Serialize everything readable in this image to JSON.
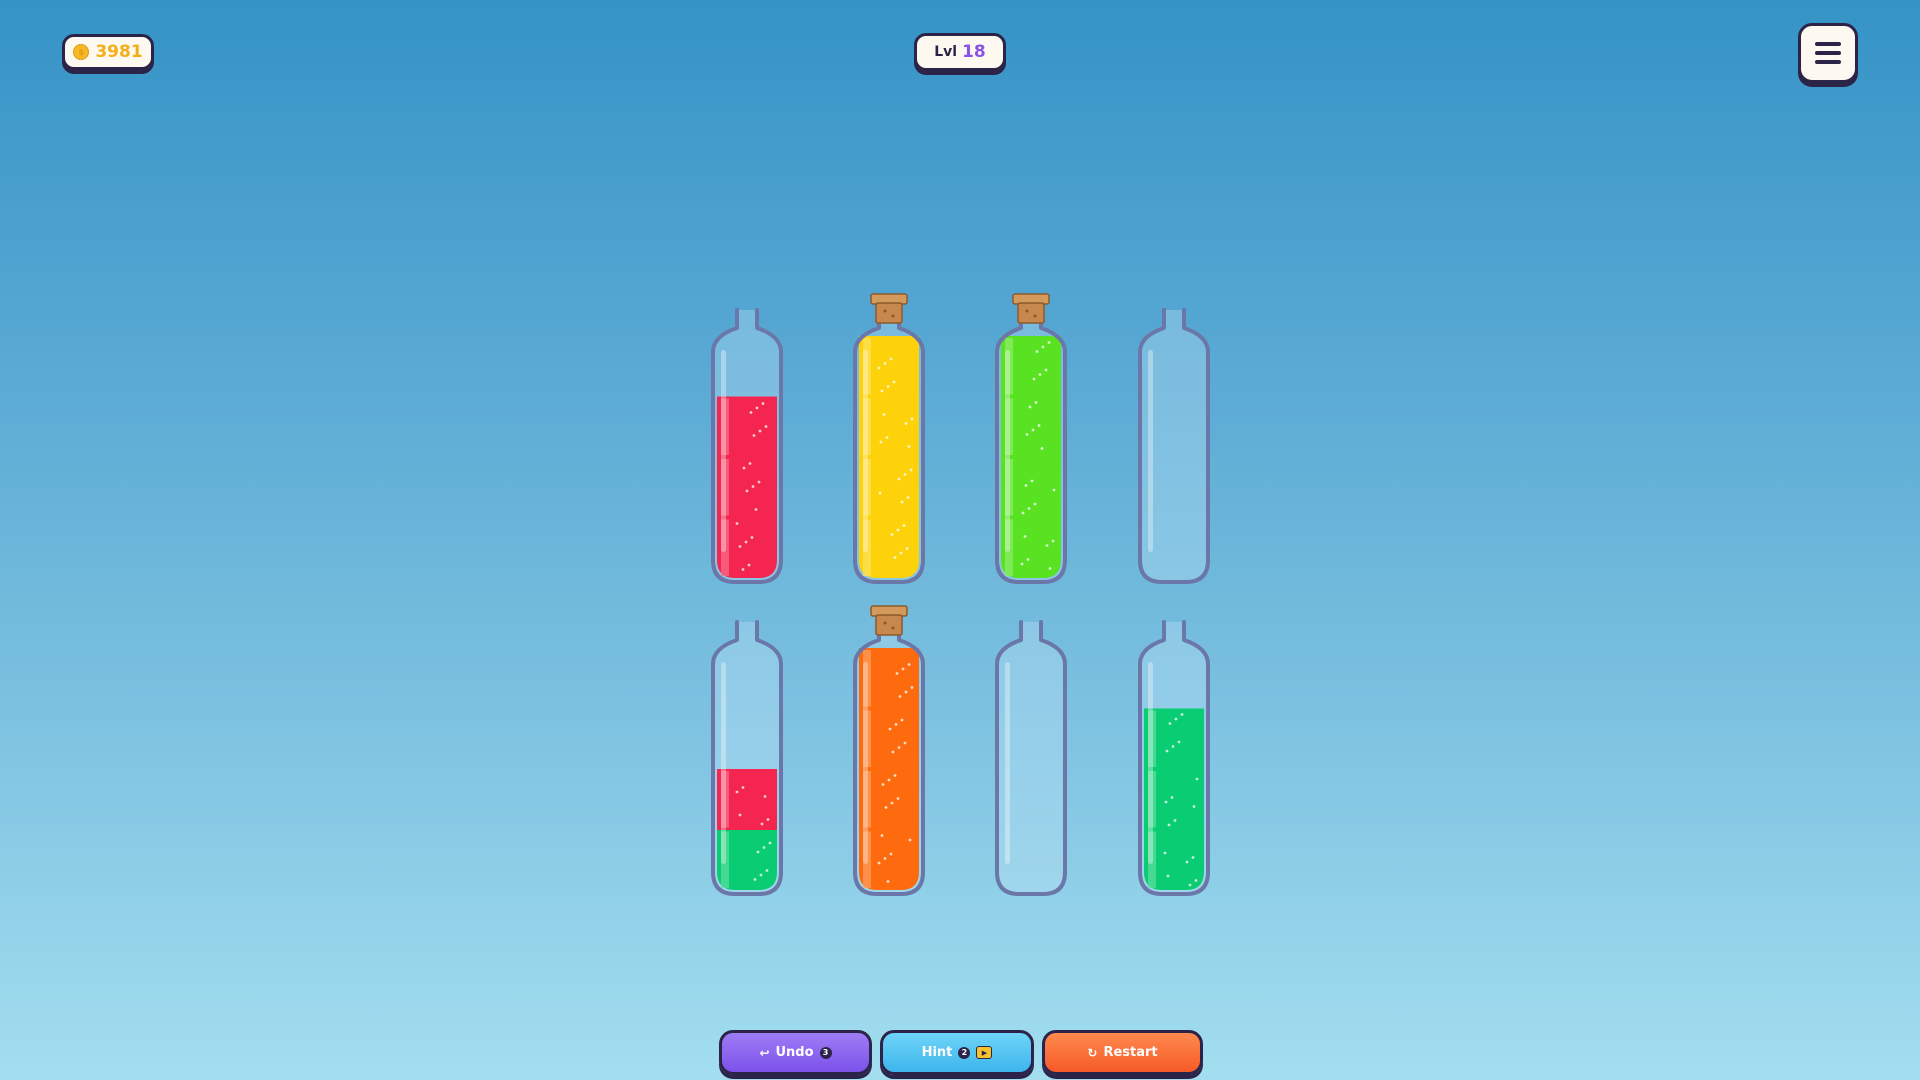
{
  "hud": {
    "coins": "3981",
    "level_prefix": "Lvl",
    "level_number": "18"
  },
  "icons": {
    "coin": "coin-icon",
    "menu": "hamburger-menu-icon",
    "undo": "undo-arrow-icon",
    "hint_video": "video-ad-icon",
    "restart": "restart-icon"
  },
  "colors": {
    "red": "#f4254f",
    "yellow": "#fdd20b",
    "lime": "#58e222",
    "emerald": "#0acc72",
    "orange": "#fd6b0e",
    "outline": "#2b2448",
    "cork": "#c8874c"
  },
  "tubes": [
    {
      "capacity": 4,
      "corked": false,
      "layers": [
        "red",
        "red",
        "red"
      ]
    },
    {
      "capacity": 4,
      "corked": true,
      "layers": [
        "yellow",
        "yellow",
        "yellow",
        "yellow"
      ]
    },
    {
      "capacity": 4,
      "corked": true,
      "layers": [
        "lime",
        "lime",
        "lime",
        "lime"
      ]
    },
    {
      "capacity": 4,
      "corked": false,
      "layers": []
    },
    {
      "capacity": 4,
      "corked": false,
      "layers": [
        "emerald",
        "red"
      ]
    },
    {
      "capacity": 4,
      "corked": true,
      "layers": [
        "orange",
        "orange",
        "orange",
        "orange"
      ]
    },
    {
      "capacity": 4,
      "corked": false,
      "layers": []
    },
    {
      "capacity": 4,
      "corked": false,
      "layers": [
        "emerald",
        "emerald",
        "emerald"
      ]
    }
  ],
  "buttons": {
    "undo_label": "Undo",
    "undo_count": "3",
    "hint_label": "Hint",
    "hint_count": "2",
    "restart_label": "Restart"
  }
}
